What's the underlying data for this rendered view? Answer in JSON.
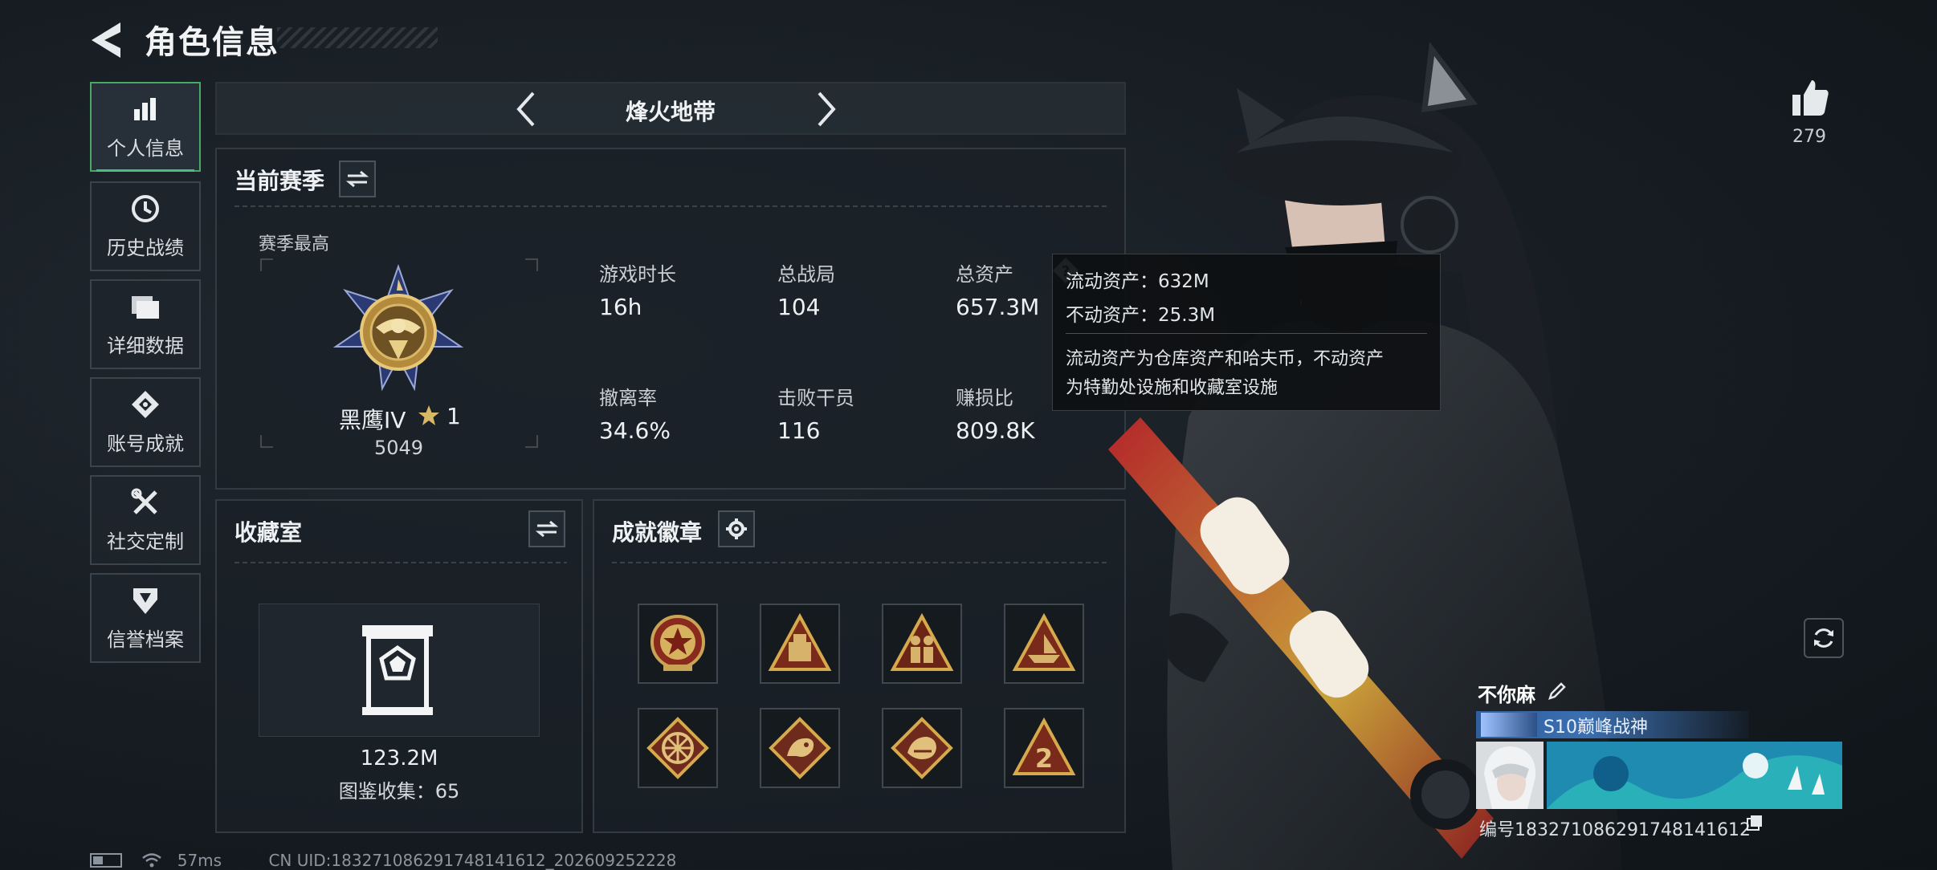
{
  "header": {
    "title": "角色信息"
  },
  "nav": [
    {
      "label": "个人信息",
      "icon": "bar-chart-icon",
      "active": true
    },
    {
      "label": "历史战绩",
      "icon": "clock-history-icon",
      "active": false
    },
    {
      "label": "详细数据",
      "icon": "folder-icon",
      "active": false
    },
    {
      "label": "账号成就",
      "icon": "achievement-diamond-icon",
      "active": false
    },
    {
      "label": "社交定制",
      "icon": "tools-icon",
      "active": false
    },
    {
      "label": "信誉档案",
      "icon": "shield-icon",
      "active": false
    }
  ],
  "mode": {
    "title": "烽火地带"
  },
  "season": {
    "title": "当前赛季",
    "best_label": "赛季最高",
    "rank_name": "黑鹰IV",
    "rank_stars": "1",
    "rank_score": "5049",
    "stats": [
      {
        "label": "游戏时长",
        "value": "16h"
      },
      {
        "label": "总战局",
        "value": "104"
      },
      {
        "label": "总资产",
        "value": "657.3M"
      },
      {
        "label": "撤离率",
        "value": "34.6%"
      },
      {
        "label": "击败干员",
        "value": "116"
      },
      {
        "label": "赚损比",
        "value": "809.8K"
      }
    ]
  },
  "tooltip": {
    "liquid": "流动资产：632M",
    "fixed": "不动资产：25.3M",
    "desc_line1": "流动资产为仓库资产和哈夫币，不动资产",
    "desc_line2": "为特勤处设施和收藏室设施"
  },
  "collection": {
    "title": "收藏室",
    "value": "123.2M",
    "count_text": "图鉴收集：65"
  },
  "achievements": {
    "title": "成就徽章",
    "badges": [
      "star-shield-badge-icon",
      "crate-badge-icon",
      "soldiers-badge-icon",
      "ship-badge-icon",
      "wheel-badge-icon",
      "dragon-badge-icon",
      "beast-badge-icon",
      "number-two-badge-icon"
    ]
  },
  "social": {
    "like_count": "279",
    "player_name": "不你麻",
    "player_title": "S10巅峰战神",
    "player_id": "编号183271086291748141612"
  },
  "status": {
    "ping": "57ms",
    "uid": "CN UID:183271086291748141612_202609252228"
  },
  "colors": {
    "accent_green": "#44c27a",
    "title_blue": "#3b6fb0",
    "gold": "#c9a455"
  }
}
